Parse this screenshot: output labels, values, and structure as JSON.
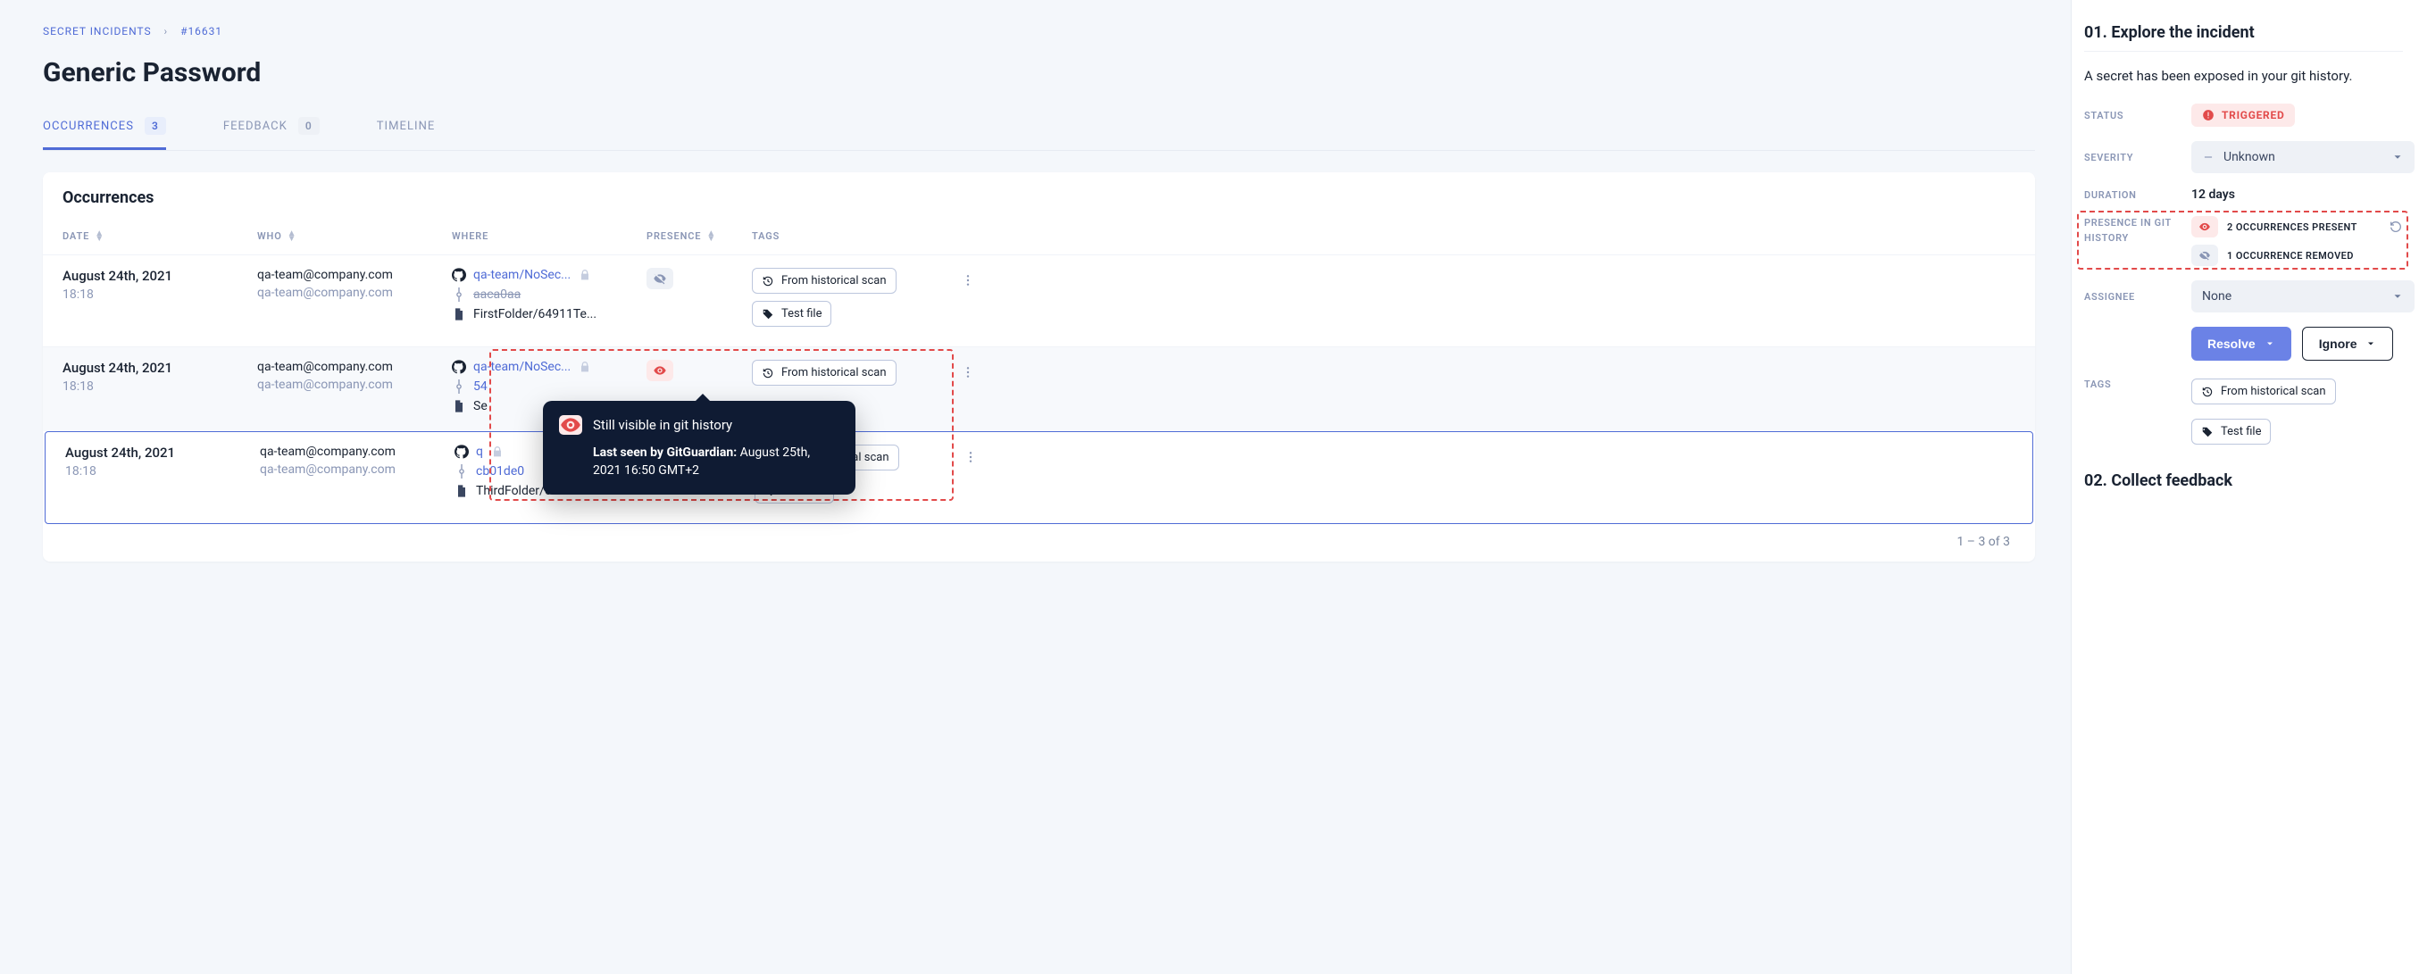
{
  "breadcrumb": {
    "root": "SECRET INCIDENTS",
    "id": "#16631"
  },
  "page_title": "Generic Password",
  "tabs": [
    {
      "label": "OCCURRENCES",
      "count": "3",
      "active": true
    },
    {
      "label": "FEEDBACK",
      "count": "0",
      "active": false
    },
    {
      "label": "TIMELINE",
      "count": null,
      "active": false
    }
  ],
  "card_title": "Occurrences",
  "columns": {
    "date": "DATE",
    "who": "WHO",
    "where": "WHERE",
    "presence": "PRESENCE",
    "tags": "TAGS"
  },
  "rows": [
    {
      "date": "August 24th, 2021",
      "time": "18:18",
      "who": "qa-team@company.com",
      "who_sub": "qa-team@company.com",
      "repo": "qa-team/NoSec...",
      "commit": "aaca0aa",
      "commit_struck": true,
      "file": "FirstFolder/64911Te...",
      "presence": "removed",
      "tags": [
        "From historical scan",
        "Test file"
      ]
    },
    {
      "date": "August 24th, 2021",
      "time": "18:18",
      "who": "qa-team@company.com",
      "who_sub": "qa-team@company.com",
      "repo": "qa-team/NoSec...",
      "commit": "54",
      "commit_struck": false,
      "file": "Se",
      "presence": "present",
      "tags": [
        "From historical scan"
      ]
    },
    {
      "date": "August 24th, 2021",
      "time": "18:18",
      "who": "qa-team@company.com",
      "who_sub": "qa-team@company.com",
      "repo": "q",
      "commit": "cb01de0",
      "commit_struck": false,
      "file": "ThirdFolder/64911Te...",
      "presence": "present",
      "tags": [
        "From historical scan",
        "Test file"
      ]
    }
  ],
  "tooltip": {
    "title": "Still visible in git history",
    "body_label": "Last seen by GitGuardian:",
    "body_value": "August 25th, 2021 16:50 GMT+2"
  },
  "pager": "1 – 3  of  3",
  "side": {
    "heading1": "01. Explore the incident",
    "sub": "A secret has been exposed in your git history.",
    "status_label": "STATUS",
    "status_value": "TRIGGERED",
    "severity_label": "SEVERITY",
    "severity_value": "Unknown",
    "duration_label": "DURATION",
    "duration_value": "12 days",
    "presence_label": "PRESENCE IN GIT HISTORY",
    "presence_present": "2 OCCURRENCES PRESENT",
    "presence_removed": "1 OCCURRENCE REMOVED",
    "assignee_label": "ASSIGNEE",
    "assignee_value": "None",
    "resolve": "Resolve",
    "ignore": "Ignore",
    "tags_label": "TAGS",
    "tags": [
      "From historical scan",
      "Test file"
    ],
    "heading2": "02. Collect feedback"
  }
}
